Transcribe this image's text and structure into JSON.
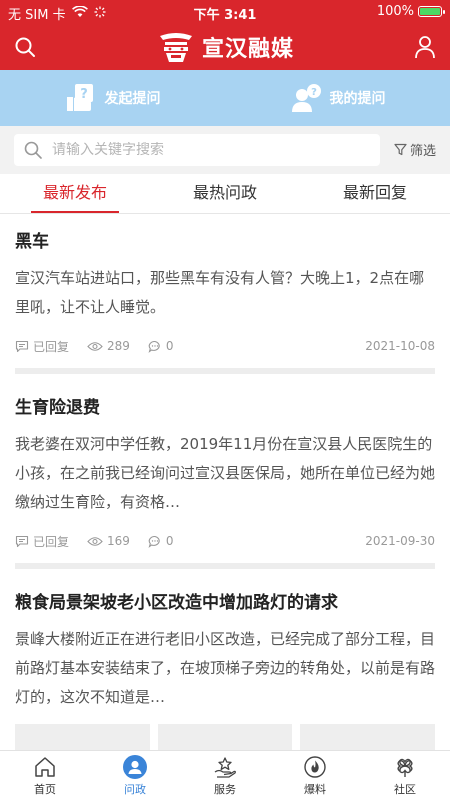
{
  "status_bar": {
    "carrier": "无 SIM 卡",
    "time": "下午 3:41",
    "battery": "100%"
  },
  "header": {
    "app_name": "宣汉融媒"
  },
  "actions": {
    "ask": "发起提问",
    "my_questions": "我的提问"
  },
  "search": {
    "placeholder": "请输入关键字搜索",
    "filter_label": "筛选"
  },
  "tabs": [
    {
      "label": "最新发布",
      "active": true
    },
    {
      "label": "最热问政",
      "active": false
    },
    {
      "label": "最新回复",
      "active": false
    }
  ],
  "posts": [
    {
      "title": "黑车",
      "body": "宣汉汽车站进站口，那些黑车有没有人管？大晚上1，2点在哪里吼，让不让人睡觉。",
      "status": "已回复",
      "views": "289",
      "comments": "0",
      "date": "2021-10-08"
    },
    {
      "title": "生育险退费",
      "body": "我老婆在双河中学任教，2019年11月份在宣汉县人民医院生的小孩，在之前我已经询问过宣汉县医保局，她所在单位已经为她缴纳过生育险，有资格…",
      "status": "已回复",
      "views": "169",
      "comments": "0",
      "date": "2021-09-30"
    },
    {
      "title": "粮食局景架坡老小区改造中增加路灯的请求",
      "body": "景峰大楼附近正在进行老旧小区改造，已经完成了部分工程，目前路灯基本安装结束了，在坡顶梯子旁边的转角处，以前是有路灯的，这次不知道是…"
    }
  ],
  "nav": [
    {
      "label": "首页",
      "icon": "home-icon",
      "active": false
    },
    {
      "label": "问政",
      "icon": "user-icon",
      "active": true
    },
    {
      "label": "服务",
      "icon": "service-icon",
      "active": false
    },
    {
      "label": "爆料",
      "icon": "fire-icon",
      "active": false
    },
    {
      "label": "社区",
      "icon": "clover-icon",
      "active": false
    }
  ],
  "colors": {
    "brand_red": "#d9262c",
    "action_blue": "#a8d3f2",
    "nav_active": "#3a84d8"
  }
}
